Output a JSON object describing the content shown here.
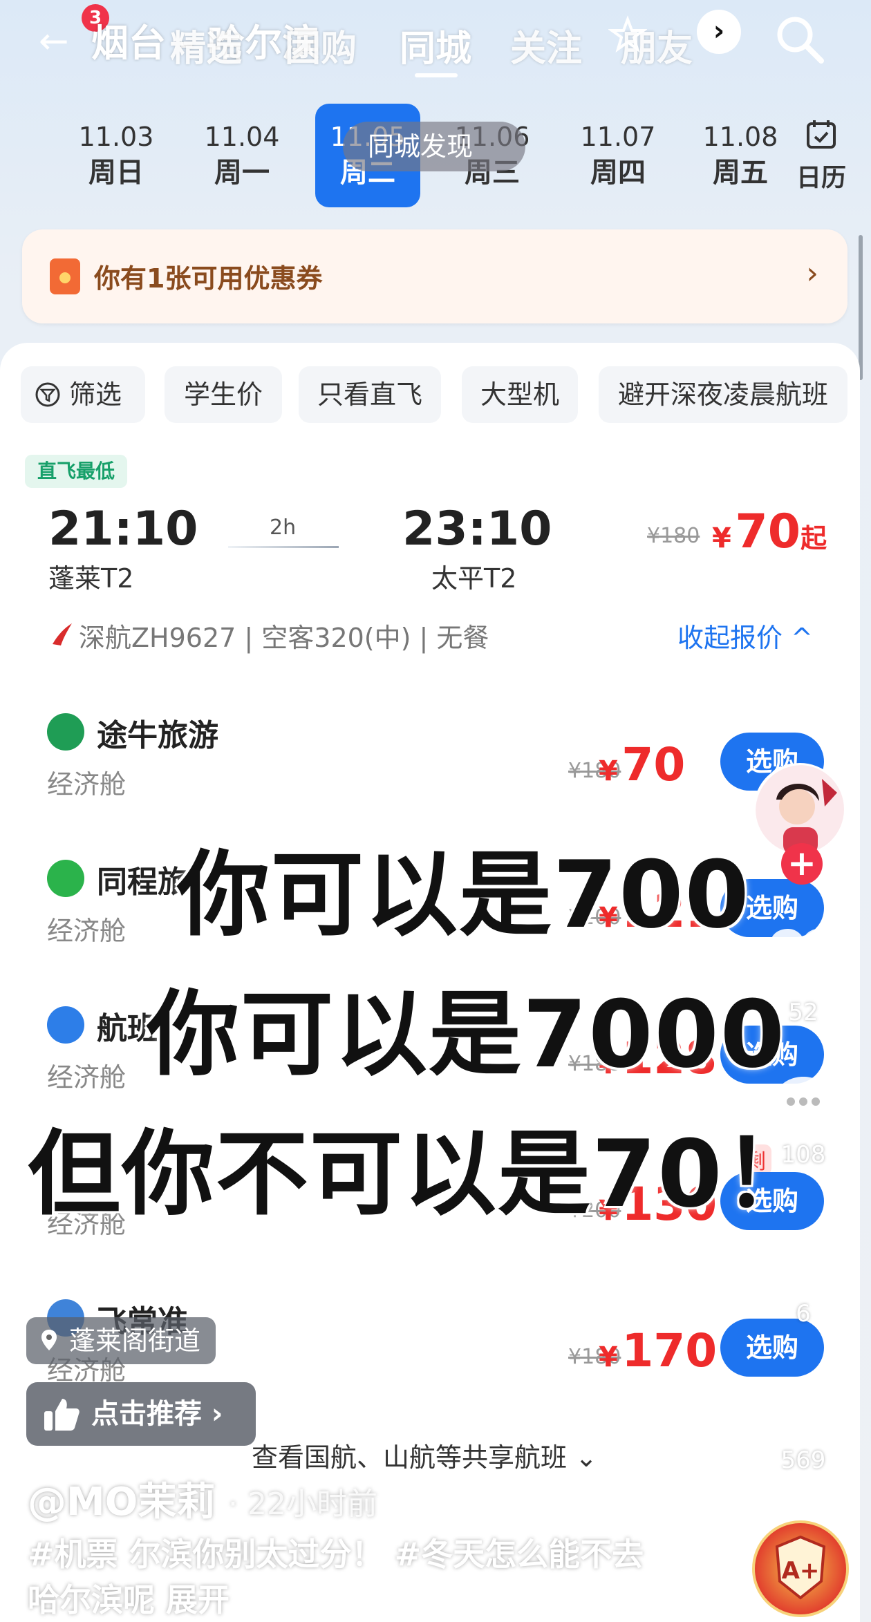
{
  "header": {
    "back_label": "←",
    "notification_count": "3",
    "route": "烟台 - 哈尔滨",
    "tabs": [
      {
        "label": "精选"
      },
      {
        "label": "团购"
      },
      {
        "label": "同城"
      },
      {
        "label": "关注"
      },
      {
        "label": "朋友"
      }
    ],
    "active_tab": "同城",
    "more_label": "›",
    "local_discover": "同城发现"
  },
  "dates": [
    {
      "date": "11.03",
      "weekday": "周日"
    },
    {
      "date": "11.04",
      "weekday": "周一"
    },
    {
      "date": "11.05",
      "weekday": "周二"
    },
    {
      "date": "11.06",
      "weekday": "周三"
    },
    {
      "date": "11.07",
      "weekday": "周四"
    },
    {
      "date": "11.08",
      "weekday": "周五"
    }
  ],
  "calendar_label": "日历",
  "coupon": {
    "text": "你有1张可用优惠券",
    "chevron": "›"
  },
  "filters": [
    "筛选",
    "学生价",
    "只看直飞",
    "大型机",
    "避开深夜凌晨航班"
  ],
  "flight": {
    "tag": "直飞最低",
    "depart_time": "21:10",
    "arrive_time": "23:10",
    "duration": "2h",
    "depart_airport": "蓬莱T2",
    "arrive_airport": "太平T2",
    "original_price": "¥180",
    "currency": "¥",
    "price": "70",
    "price_suffix": "起",
    "airline_info": "深航ZH9627 | 空客320(中) | 无餐",
    "collapse_label": "收起报价 ^"
  },
  "vendors": [
    {
      "name": "途牛旅游",
      "cabin": "经济舱",
      "original_price": "¥180",
      "currency": "¥",
      "price": "70",
      "button": "选购"
    },
    {
      "name": "同程旅",
      "cabin": "经济舱",
      "original_price": "¥200",
      "currency": "¥",
      "price": "121",
      "button": "选购"
    },
    {
      "name": "航班",
      "cabin": "经济舱",
      "original_price": "¥180",
      "currency": "¥",
      "price": "128",
      "button": "选购"
    },
    {
      "name": "",
      "cabin": "经济舱",
      "original_price": "¥200",
      "currency": "¥",
      "price": "130",
      "button": "选购"
    },
    {
      "name": "飞常准",
      "cabin": "经济舱",
      "original_price": "¥180",
      "currency": "¥",
      "price": "170",
      "button": "选购"
    }
  ],
  "remaining_label": "剩",
  "shared_flights": "查看国航、山航等共享航班 ⌄",
  "overlay_lines": [
    "你可以是700",
    "你可以是7000",
    "但你不可以是70！"
  ],
  "location": "蓬莱阁街道",
  "recommend": "点击推荐 ›",
  "author": "@MO茉莉",
  "post_time": "· 22小时前",
  "description_line1": "#机票 尔滨你别太过分！ #冬天怎么能不去",
  "description_line2": "哈尔滨呢  展开",
  "side": {
    "like_count": "52",
    "comment_count": "108",
    "favorite_count": "6",
    "share_count": "569"
  },
  "follow_label": "+",
  "colors": {
    "accent": "#1e74f0",
    "price": "#ee2b2b",
    "badge": "#f0334a"
  }
}
